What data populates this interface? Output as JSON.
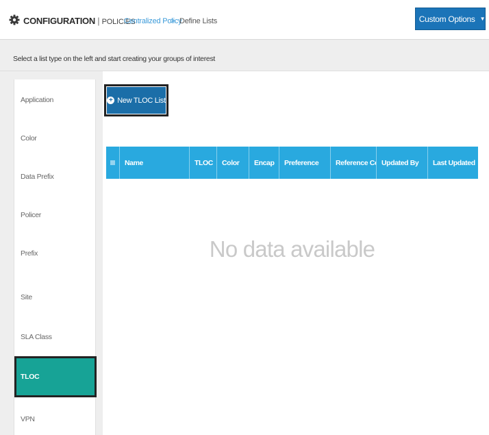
{
  "header": {
    "title": "CONFIGURATION",
    "separator": "|",
    "subtitle": "POLICIES",
    "breadcrumb_link": "Centralized Policy",
    "breadcrumb_arrow": ">",
    "breadcrumb_current": "Define Lists",
    "custom_options_label": "Custom Options"
  },
  "instruction": "Select a list type on the left and start creating your groups of interest",
  "sidebar": {
    "items": [
      {
        "label": "Application"
      },
      {
        "label": "Color"
      },
      {
        "label": "Data Prefix"
      },
      {
        "label": "Policer"
      },
      {
        "label": "Prefix"
      },
      {
        "label": "Site"
      },
      {
        "label": "SLA Class"
      },
      {
        "label": "TLOC",
        "active": true
      },
      {
        "label": "VPN"
      }
    ]
  },
  "main": {
    "new_button_label": "New TLOC List",
    "table": {
      "columns": [
        "Name",
        "TLOC",
        "Color",
        "Encap",
        "Preference",
        "Reference Co...",
        "Updated By",
        "Last Updated"
      ]
    },
    "empty_message": "No data available"
  },
  "colors": {
    "accent_blue": "#1b74b8",
    "table_header": "#29a9df",
    "active_item": "#17a396",
    "link": "#3a9ad9"
  },
  "icons": {
    "settings": "gear-icon",
    "options": "square-icon",
    "dropdown": "caret-down-icon",
    "add": "plus-circle-icon"
  }
}
